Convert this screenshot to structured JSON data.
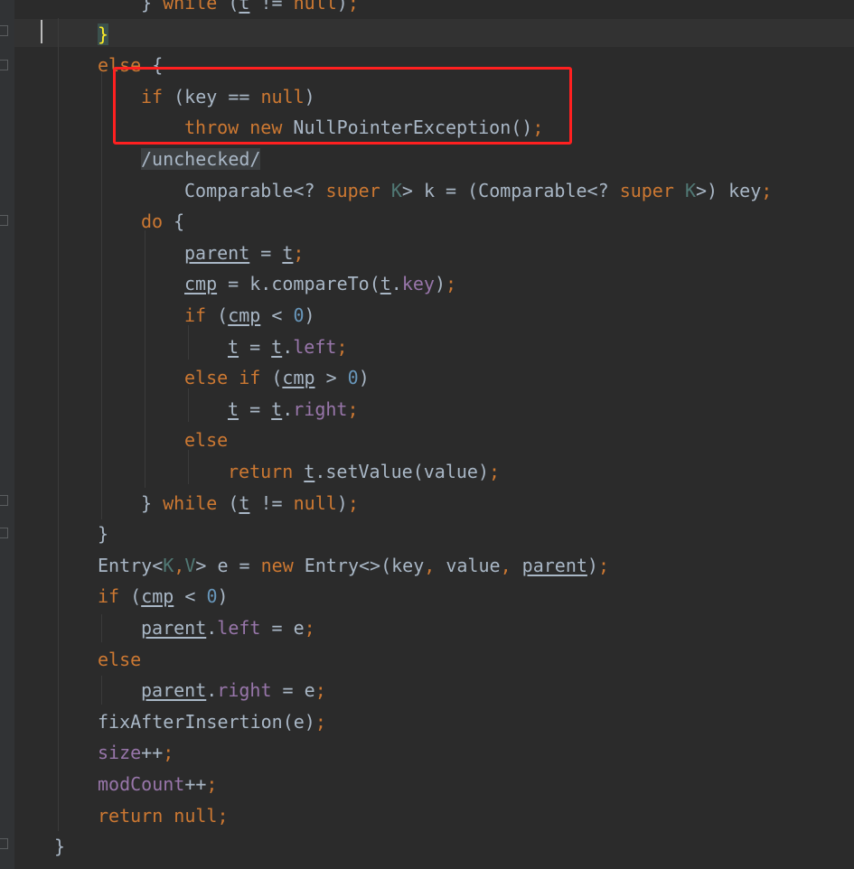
{
  "editor": {
    "lines": [
      {
        "id": "l0",
        "indent": 2,
        "tokens": [
          {
            "t": "} ",
            "c": "pl"
          },
          {
            "t": "while",
            "c": "kw"
          },
          {
            "t": " (",
            "c": "pl"
          },
          {
            "t": "t",
            "c": "pl ul"
          },
          {
            "t": " != ",
            "c": "pl"
          },
          {
            "t": "null",
            "c": "kw"
          },
          {
            "t": ")",
            "c": "pl"
          },
          {
            "t": ";",
            "c": "kw"
          }
        ]
      },
      {
        "id": "l1",
        "indent": 1,
        "tokens": [
          {
            "t": "}",
            "c": "brace-match"
          }
        ]
      },
      {
        "id": "l2",
        "indent": 1,
        "tokens": [
          {
            "t": "else",
            "c": "kw"
          },
          {
            "t": " {",
            "c": "pl"
          }
        ]
      },
      {
        "id": "l3",
        "indent": 2,
        "tokens": [
          {
            "t": "if",
            "c": "kw"
          },
          {
            "t": " (key == ",
            "c": "pl"
          },
          {
            "t": "null",
            "c": "kw"
          },
          {
            "t": ")",
            "c": "pl"
          }
        ]
      },
      {
        "id": "l4",
        "indent": 3,
        "tokens": [
          {
            "t": "throw",
            "c": "kw"
          },
          {
            "t": " ",
            "c": "pl"
          },
          {
            "t": "new",
            "c": "kw"
          },
          {
            "t": " NullPointerException()",
            "c": "pl"
          },
          {
            "t": ";",
            "c": "kw"
          }
        ]
      },
      {
        "id": "l5",
        "indent": 2,
        "tokens": [
          {
            "t": "/unchecked/",
            "c": "annot-bg"
          }
        ]
      },
      {
        "id": "l6",
        "indent": 3,
        "tokens": [
          {
            "t": "Comparable<? ",
            "c": "pl"
          },
          {
            "t": "super",
            "c": "kw"
          },
          {
            "t": " ",
            "c": "pl"
          },
          {
            "t": "K",
            "c": "typ"
          },
          {
            "t": "> k = (Comparable<? ",
            "c": "pl"
          },
          {
            "t": "super",
            "c": "kw"
          },
          {
            "t": " ",
            "c": "pl"
          },
          {
            "t": "K",
            "c": "typ"
          },
          {
            "t": ">) key",
            "c": "pl"
          },
          {
            "t": ";",
            "c": "kw"
          }
        ]
      },
      {
        "id": "l7",
        "indent": 2,
        "tokens": [
          {
            "t": "do",
            "c": "kw"
          },
          {
            "t": " {",
            "c": "pl"
          }
        ]
      },
      {
        "id": "l8",
        "indent": 3,
        "tokens": [
          {
            "t": "parent",
            "c": "pl ul"
          },
          {
            "t": " = ",
            "c": "pl"
          },
          {
            "t": "t",
            "c": "pl ul"
          },
          {
            "t": ";",
            "c": "kw"
          }
        ]
      },
      {
        "id": "l9",
        "indent": 3,
        "tokens": [
          {
            "t": "cmp",
            "c": "pl ul"
          },
          {
            "t": " = k.compareTo(",
            "c": "pl"
          },
          {
            "t": "t",
            "c": "pl ul"
          },
          {
            "t": ".",
            "c": "pl"
          },
          {
            "t": "key",
            "c": "fld"
          },
          {
            "t": ")",
            "c": "pl"
          },
          {
            "t": ";",
            "c": "kw"
          }
        ]
      },
      {
        "id": "l10",
        "indent": 3,
        "tokens": [
          {
            "t": "if",
            "c": "kw"
          },
          {
            "t": " (",
            "c": "pl"
          },
          {
            "t": "cmp",
            "c": "pl ul"
          },
          {
            "t": " < ",
            "c": "pl"
          },
          {
            "t": "0",
            "c": "num"
          },
          {
            "t": ")",
            "c": "pl"
          }
        ]
      },
      {
        "id": "l11",
        "indent": 4,
        "tokens": [
          {
            "t": "t",
            "c": "pl ul"
          },
          {
            "t": " = ",
            "c": "pl"
          },
          {
            "t": "t",
            "c": "pl ul"
          },
          {
            "t": ".",
            "c": "pl"
          },
          {
            "t": "left",
            "c": "fld"
          },
          {
            "t": ";",
            "c": "kw"
          }
        ]
      },
      {
        "id": "l12",
        "indent": 3,
        "tokens": [
          {
            "t": "else",
            "c": "kw"
          },
          {
            "t": " ",
            "c": "pl"
          },
          {
            "t": "if",
            "c": "kw"
          },
          {
            "t": " (",
            "c": "pl"
          },
          {
            "t": "cmp",
            "c": "pl ul"
          },
          {
            "t": " > ",
            "c": "pl"
          },
          {
            "t": "0",
            "c": "num"
          },
          {
            "t": ")",
            "c": "pl"
          }
        ]
      },
      {
        "id": "l13",
        "indent": 4,
        "tokens": [
          {
            "t": "t",
            "c": "pl ul"
          },
          {
            "t": " = ",
            "c": "pl"
          },
          {
            "t": "t",
            "c": "pl ul"
          },
          {
            "t": ".",
            "c": "pl"
          },
          {
            "t": "right",
            "c": "fld"
          },
          {
            "t": ";",
            "c": "kw"
          }
        ]
      },
      {
        "id": "l14",
        "indent": 3,
        "tokens": [
          {
            "t": "else",
            "c": "kw"
          }
        ]
      },
      {
        "id": "l15",
        "indent": 4,
        "tokens": [
          {
            "t": "return",
            "c": "kw"
          },
          {
            "t": " ",
            "c": "pl"
          },
          {
            "t": "t",
            "c": "pl ul"
          },
          {
            "t": ".setValue(value)",
            "c": "pl"
          },
          {
            "t": ";",
            "c": "kw"
          }
        ]
      },
      {
        "id": "l16",
        "indent": 2,
        "tokens": [
          {
            "t": "} ",
            "c": "pl"
          },
          {
            "t": "while",
            "c": "kw"
          },
          {
            "t": " (",
            "c": "pl"
          },
          {
            "t": "t",
            "c": "pl ul"
          },
          {
            "t": " != ",
            "c": "pl"
          },
          {
            "t": "null",
            "c": "kw"
          },
          {
            "t": ")",
            "c": "pl"
          },
          {
            "t": ";",
            "c": "kw"
          }
        ]
      },
      {
        "id": "l17",
        "indent": 1,
        "tokens": [
          {
            "t": "}",
            "c": "pl"
          }
        ]
      },
      {
        "id": "l18",
        "indent": 1,
        "tokens": [
          {
            "t": "Entry<",
            "c": "pl"
          },
          {
            "t": "K",
            "c": "typ"
          },
          {
            "t": ",",
            "c": "kw"
          },
          {
            "t": "V",
            "c": "typ"
          },
          {
            "t": "> e = ",
            "c": "pl"
          },
          {
            "t": "new",
            "c": "kw"
          },
          {
            "t": " Entry<>(key",
            "c": "pl"
          },
          {
            "t": ",",
            "c": "kw"
          },
          {
            "t": " value",
            "c": "pl"
          },
          {
            "t": ",",
            "c": "kw"
          },
          {
            "t": " ",
            "c": "pl"
          },
          {
            "t": "parent",
            "c": "pl ul"
          },
          {
            "t": ")",
            "c": "pl"
          },
          {
            "t": ";",
            "c": "kw"
          }
        ]
      },
      {
        "id": "l19",
        "indent": 1,
        "tokens": [
          {
            "t": "if",
            "c": "kw"
          },
          {
            "t": " (",
            "c": "pl"
          },
          {
            "t": "cmp",
            "c": "pl ul"
          },
          {
            "t": " < ",
            "c": "pl"
          },
          {
            "t": "0",
            "c": "num"
          },
          {
            "t": ")",
            "c": "pl"
          }
        ]
      },
      {
        "id": "l20",
        "indent": 2,
        "tokens": [
          {
            "t": "parent",
            "c": "pl ul"
          },
          {
            "t": ".",
            "c": "pl"
          },
          {
            "t": "left",
            "c": "fld"
          },
          {
            "t": " = e",
            "c": "pl"
          },
          {
            "t": ";",
            "c": "kw"
          }
        ]
      },
      {
        "id": "l21",
        "indent": 1,
        "tokens": [
          {
            "t": "else",
            "c": "kw"
          }
        ]
      },
      {
        "id": "l22",
        "indent": 2,
        "tokens": [
          {
            "t": "parent",
            "c": "pl ul"
          },
          {
            "t": ".",
            "c": "pl"
          },
          {
            "t": "right",
            "c": "fld"
          },
          {
            "t": " = e",
            "c": "pl"
          },
          {
            "t": ";",
            "c": "kw"
          }
        ]
      },
      {
        "id": "l23",
        "indent": 1,
        "tokens": [
          {
            "t": "fixAfterInsertion(e)",
            "c": "pl"
          },
          {
            "t": ";",
            "c": "kw"
          }
        ]
      },
      {
        "id": "l24",
        "indent": 1,
        "tokens": [
          {
            "t": "size",
            "c": "fld"
          },
          {
            "t": "++",
            "c": "pl"
          },
          {
            "t": ";",
            "c": "kw"
          }
        ]
      },
      {
        "id": "l25",
        "indent": 1,
        "tokens": [
          {
            "t": "modCount",
            "c": "fld"
          },
          {
            "t": "++",
            "c": "pl"
          },
          {
            "t": ";",
            "c": "kw"
          }
        ]
      },
      {
        "id": "l26",
        "indent": 1,
        "tokens": [
          {
            "t": "return",
            "c": "kw"
          },
          {
            "t": " ",
            "c": "pl"
          },
          {
            "t": "null",
            "c": "kw"
          },
          {
            "t": ";",
            "c": "kw"
          }
        ]
      },
      {
        "id": "l27",
        "indent": 0,
        "tokens": [
          {
            "t": "}",
            "c": "pl"
          }
        ]
      }
    ],
    "colors": {
      "background": "#2b2b2b",
      "keyword": "#cc7832",
      "field": "#9876aa",
      "number": "#6897bb",
      "type_param": "#507874",
      "plain": "#a9b7c6",
      "highlight_box": "#ff2020"
    }
  }
}
